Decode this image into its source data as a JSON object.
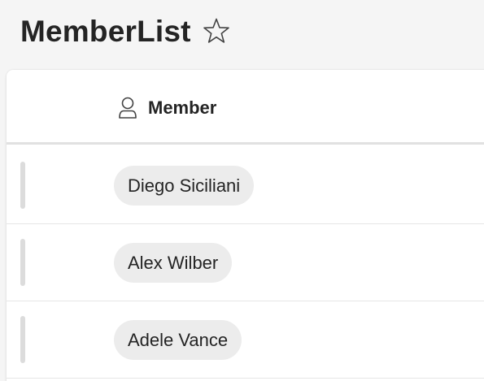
{
  "page": {
    "title": "MemberList",
    "favorite_icon": "star-outline-icon"
  },
  "list": {
    "columns": [
      {
        "label": "Member",
        "icon": "person-icon"
      }
    ],
    "rows": [
      {
        "member": "Diego Siciliani"
      },
      {
        "member": "Alex Wilber"
      },
      {
        "member": "Adele Vance"
      }
    ]
  },
  "colors": {
    "background": "#f5f5f5",
    "card": "#ffffff",
    "text": "#242424",
    "pill": "#ececec",
    "handle": "#dcdcdc",
    "divider": "#e1e1e1"
  }
}
